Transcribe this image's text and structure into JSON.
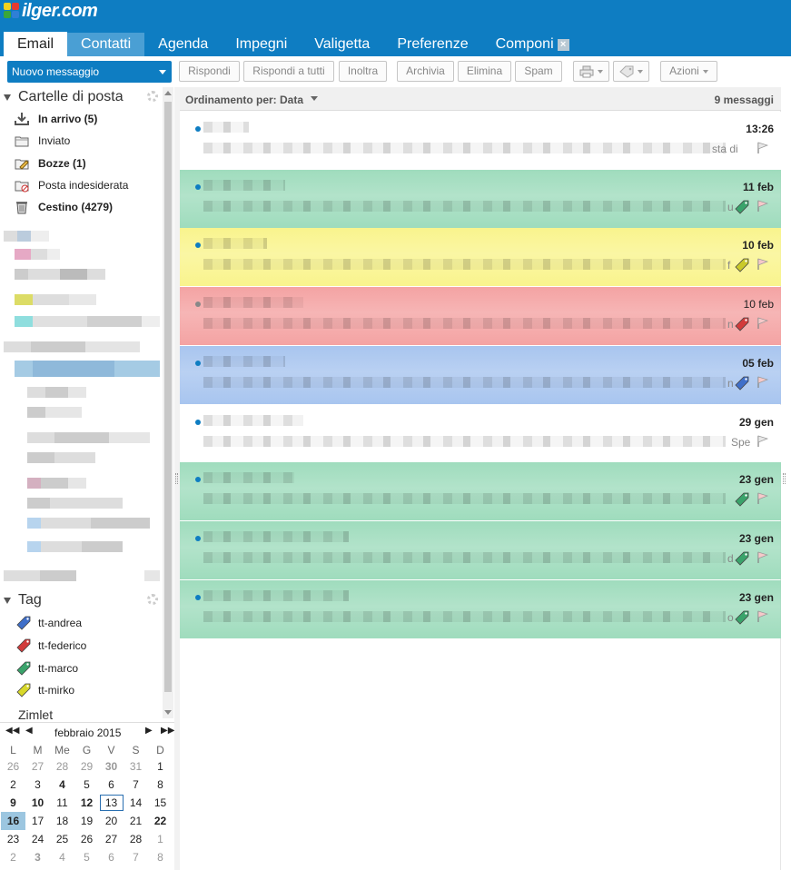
{
  "app": {
    "brand": "ilger.com"
  },
  "tabs": [
    {
      "label": "Email",
      "active": true
    },
    {
      "label": "Contatti",
      "hover": true
    },
    {
      "label": "Agenda"
    },
    {
      "label": "Impegni"
    },
    {
      "label": "Valigetta"
    },
    {
      "label": "Preferenze"
    },
    {
      "label": "Componi",
      "closable": true
    }
  ],
  "toolbar": {
    "new_message": "Nuovo messaggio",
    "reply": "Rispondi",
    "reply_all": "Rispondi a tutti",
    "forward": "Inoltra",
    "archive": "Archivia",
    "delete": "Elimina",
    "spam": "Spam",
    "actions": "Azioni"
  },
  "folders_section": {
    "title": "Cartelle di posta",
    "items": [
      {
        "name": "inbox",
        "label": "In arrivo (5)",
        "bold": true,
        "icon": "inbox-download-icon"
      },
      {
        "name": "sent",
        "label": "Inviato",
        "bold": false,
        "icon": "sent-folder-icon"
      },
      {
        "name": "drafts",
        "label": "Bozze (1)",
        "bold": true,
        "icon": "drafts-pencil-icon"
      },
      {
        "name": "junk",
        "label": "Posta indesiderata",
        "bold": false,
        "icon": "junk-folder-icon"
      },
      {
        "name": "trash",
        "label": "Cestino (4279)",
        "bold": true,
        "icon": "trash-icon"
      }
    ]
  },
  "tags_section": {
    "title": "Tag",
    "items": [
      {
        "label": "tt-andrea",
        "color": "#3f6fc9"
      },
      {
        "label": "tt-federico",
        "color": "#d23b3b"
      },
      {
        "label": "tt-marco",
        "color": "#3aa36b"
      },
      {
        "label": "tt-mirko",
        "color": "#d8d82a"
      }
    ],
    "next_section_partial": "Zimlet"
  },
  "calendar": {
    "month": "febbraio 2015",
    "weekdays": [
      "L",
      "M",
      "Me",
      "G",
      "V",
      "S",
      "D"
    ],
    "weeks": [
      [
        {
          "d": "26",
          "o": true
        },
        {
          "d": "27",
          "o": true
        },
        {
          "d": "28",
          "o": true
        },
        {
          "d": "29",
          "o": true
        },
        {
          "d": "30",
          "o": true,
          "b": true
        },
        {
          "d": "31",
          "o": true
        },
        {
          "d": "1"
        }
      ],
      [
        {
          "d": "2"
        },
        {
          "d": "3"
        },
        {
          "d": "4",
          "b": true
        },
        {
          "d": "5"
        },
        {
          "d": "6"
        },
        {
          "d": "7"
        },
        {
          "d": "8"
        }
      ],
      [
        {
          "d": "9",
          "b": true
        },
        {
          "d": "10",
          "b": true
        },
        {
          "d": "11"
        },
        {
          "d": "12",
          "b": true
        },
        {
          "d": "13",
          "today": true
        },
        {
          "d": "14"
        },
        {
          "d": "15"
        }
      ],
      [
        {
          "d": "16",
          "sel": true
        },
        {
          "d": "17"
        },
        {
          "d": "18"
        },
        {
          "d": "19"
        },
        {
          "d": "20"
        },
        {
          "d": "21"
        },
        {
          "d": "22",
          "b": true
        }
      ],
      [
        {
          "d": "23"
        },
        {
          "d": "24"
        },
        {
          "d": "25"
        },
        {
          "d": "26"
        },
        {
          "d": "27"
        },
        {
          "d": "28"
        },
        {
          "d": "1",
          "o": true
        }
      ],
      [
        {
          "d": "2",
          "o": true
        },
        {
          "d": "3",
          "o": true,
          "b": true
        },
        {
          "d": "4",
          "o": true
        },
        {
          "d": "5",
          "o": true
        },
        {
          "d": "6",
          "o": true
        },
        {
          "d": "7",
          "o": true
        },
        {
          "d": "8",
          "o": true
        }
      ]
    ]
  },
  "list": {
    "sort_label": "Ordinamento per: Data",
    "count_label": "9 messaggi",
    "messages": [
      {
        "date": "13:26",
        "unread": true,
        "bg": "#ffffff",
        "tag": null,
        "trail": "sta di"
      },
      {
        "date": "11 feb",
        "unread": true,
        "bg": "#9fdcbd",
        "tag": "#3aa36b",
        "trail": "u"
      },
      {
        "date": "10 feb",
        "unread": true,
        "bg": "#f9f48d",
        "tag": "#c9c92a",
        "trail": "f"
      },
      {
        "date": "10 feb",
        "unread": false,
        "bg": "#f4a3a3",
        "tag": "#d23b3b",
        "trail": "n"
      },
      {
        "date": "05 feb",
        "unread": true,
        "bg": "#a8c5ef",
        "tag": "#3f6fc9",
        "trail": "n"
      },
      {
        "date": "29 gen",
        "unread": true,
        "bg": "#ffffff",
        "tag": null,
        "trail": "Spe"
      },
      {
        "date": "23 gen",
        "unread": true,
        "bg": "#9fdcbd",
        "tag": "#3aa36b",
        "trail": ""
      },
      {
        "date": "23 gen",
        "unread": true,
        "bg": "#9fdcbd",
        "tag": "#3aa36b",
        "trail": "d"
      },
      {
        "date": "23 gen",
        "unread": true,
        "bg": "#9fdcbd",
        "tag": "#3aa36b",
        "trail": "o"
      }
    ]
  }
}
